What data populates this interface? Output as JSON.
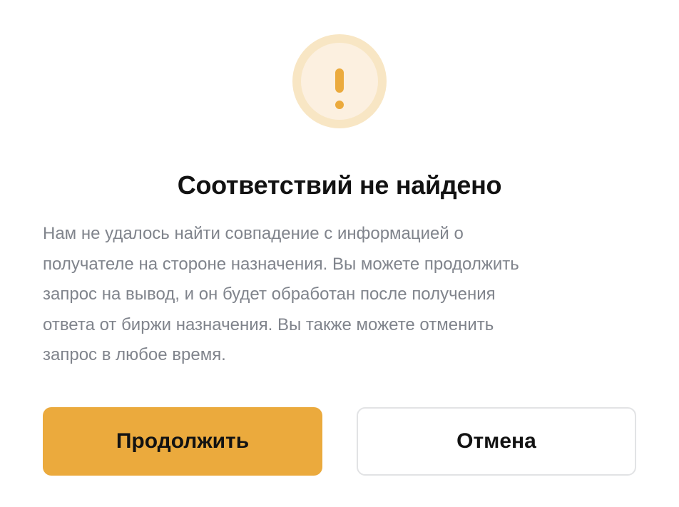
{
  "dialog": {
    "icon": "warning-exclamation-icon",
    "title": "Соответствий не найдено",
    "message_lines": [
      "Нам не удалось найти совпадение с информацией о",
      "получателе на стороне назначения. Вы можете продолжить",
      "запрос на вывод, и он будет обработан после получения",
      "ответа от биржи назначения. Вы также можете отменить",
      "запрос в любое время."
    ],
    "continue_label": "Продолжить",
    "cancel_label": "Отмена"
  },
  "colors": {
    "accent": "#ebaa3d",
    "icon_ring": "#f8e6c4",
    "icon_fill": "#fcf0e0",
    "icon_mark": "#ebaa3d",
    "title": "#121212",
    "message": "#80848c",
    "border": "#e2e3e5"
  }
}
